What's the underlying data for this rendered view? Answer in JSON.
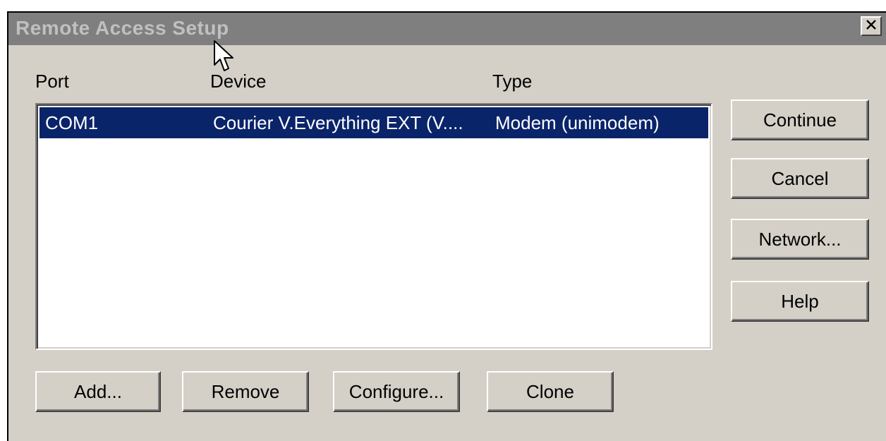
{
  "window": {
    "title": "Remote Access Setup",
    "close_glyph": "✕"
  },
  "columns": {
    "port": "Port",
    "device": "Device",
    "type": "Type"
  },
  "ports": [
    {
      "port": "COM1",
      "device": "Courier V.Everything EXT (V....",
      "type": "Modem (unimodem)",
      "selected": true
    }
  ],
  "side_buttons": {
    "continue": "Continue",
    "cancel": "Cancel",
    "network": "Network...",
    "help": "Help"
  },
  "bottom_buttons": {
    "add": "Add...",
    "remove": "Remove",
    "configure": "Configure...",
    "clone": "Clone"
  },
  "colors": {
    "selection": "#0a246a",
    "face": "#d4d0c8",
    "titlebar": "#7f7f7f"
  },
  "icons": {
    "close": "close-icon",
    "cursor": "mouse-pointer-icon"
  }
}
